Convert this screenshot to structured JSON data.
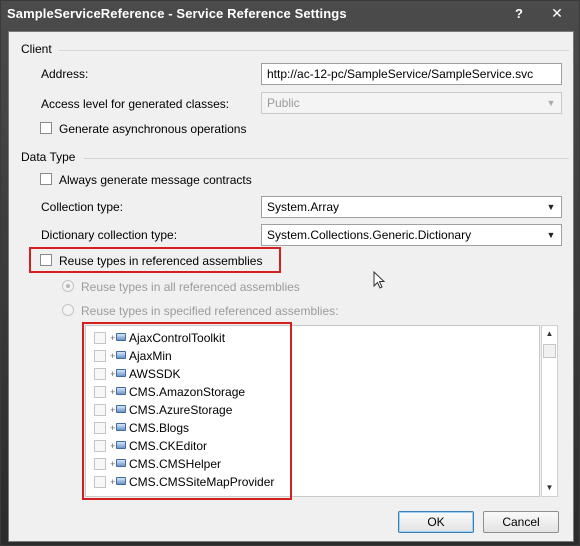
{
  "window": {
    "title": "SampleServiceReference - Service Reference Settings",
    "help_button": "?",
    "close_button": "✕"
  },
  "client_group": {
    "label": "Client",
    "address_label": "Address:",
    "address_value": "http://ac-12-pc/SampleService/SampleService.svc",
    "access_level_label": "Access level for generated classes:",
    "access_level_value": "Public",
    "async_label": "Generate asynchronous operations"
  },
  "data_type_group": {
    "label": "Data Type",
    "always_generate_label": "Always generate message contracts",
    "collection_type_label": "Collection type:",
    "collection_type_value": "System.Array",
    "dictionary_type_label": "Dictionary collection type:",
    "dictionary_type_value": "System.Collections.Generic.Dictionary",
    "reuse_types_label": "Reuse types in referenced assemblies",
    "reuse_all_label": "Reuse types in all referenced assemblies",
    "reuse_specified_label": "Reuse types in specified referenced assemblies:"
  },
  "assemblies": [
    "AjaxControlToolkit",
    "AjaxMin",
    "AWSSDK",
    "CMS.AmazonStorage",
    "CMS.AzureStorage",
    "CMS.Blogs",
    "CMS.CKEditor",
    "CMS.CMSHelper",
    "CMS.CMSSiteMapProvider"
  ],
  "buttons": {
    "ok": "OK",
    "cancel": "Cancel"
  },
  "icons": [
    "help-icon",
    "close-icon",
    "chevron-down-icon",
    "assembly-icon",
    "scroll-up-icon",
    "scroll-down-icon",
    "mouse-pointer-icon"
  ],
  "colors": {
    "titlebar": "#333333",
    "highlight_box": "#d21f1f",
    "dialog_bg": "#f0f0f0"
  }
}
